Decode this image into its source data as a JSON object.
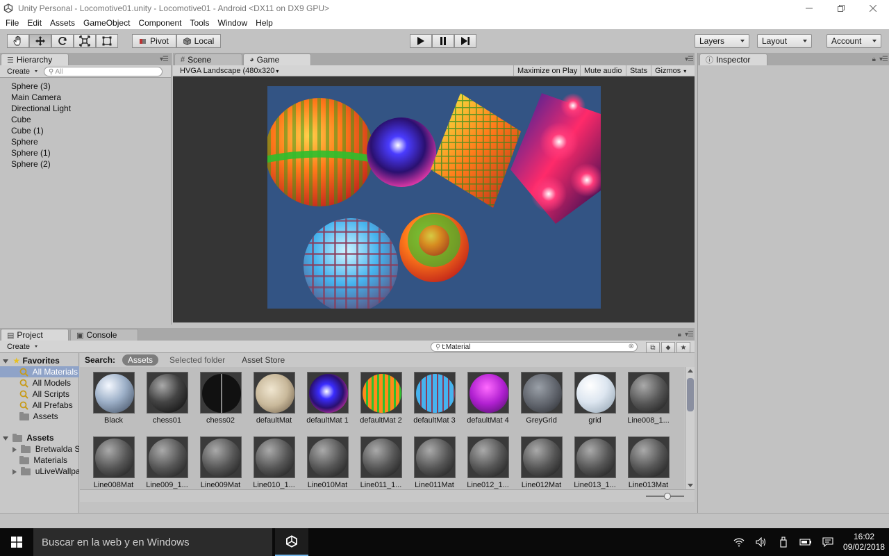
{
  "window": {
    "title": "Unity Personal - Locomotive01.unity - Locomotive01 - Android <DX11 on DX9 GPU>"
  },
  "menu": [
    "File",
    "Edit",
    "Assets",
    "GameObject",
    "Component",
    "Tools",
    "Window",
    "Help"
  ],
  "toolbar": {
    "pivot_label": "Pivot",
    "local_label": "Local",
    "layers_label": "Layers",
    "layout_label": "Layout",
    "account_label": "Account"
  },
  "hierarchy": {
    "tab_label": "Hierarchy",
    "create_label": "Create",
    "search_placeholder": "All",
    "items": [
      "Sphere (3)",
      "Main Camera",
      "Directional Light",
      "Cube",
      "Cube (1)",
      "Sphere",
      "Sphere (1)",
      "Sphere (2)"
    ]
  },
  "scene_tab": {
    "label": "Scene"
  },
  "game": {
    "tab_label": "Game",
    "resolution": "HVGA Landscape (480x320",
    "maximize_label": "Maximize on Play",
    "mute_label": "Mute audio",
    "stats_label": "Stats",
    "gizmos_label": "Gizmos"
  },
  "inspector": {
    "tab_label": "Inspector"
  },
  "project": {
    "tab_label": "Project",
    "console_label": "Console",
    "create_label": "Create",
    "search_value": "t:Material",
    "search_label": "Search:",
    "scope_assets": "Assets",
    "scope_selected": "Selected folder",
    "scope_store": "Asset Store",
    "favorites_label": "Favorites",
    "favorites": [
      "All Materials",
      "All Models",
      "All Scripts",
      "All Prefabs",
      "Assets"
    ],
    "assets_label": "Assets",
    "folders": [
      "Bretwalda S",
      "Materials",
      "uLiveWallpa"
    ],
    "materials_row1": [
      "Black",
      "chess01",
      "chess02",
      "defaultMat",
      "defaultMat 1",
      "defaultMat 2",
      "defaultMat 3",
      "defaultMat 4",
      "GreyGrid",
      "grid",
      "Line008_1..."
    ],
    "materials_row2": [
      "Line008Mat",
      "Line009_1...",
      "Line009Mat",
      "Line010_1...",
      "Line010Mat",
      "Line011_1...",
      "Line011Mat",
      "Line012_1...",
      "Line012Mat",
      "Line013_1...",
      "Line013Mat"
    ]
  },
  "taskbar": {
    "search_placeholder": "Buscar en la web y en Windows",
    "time": "16:02",
    "date": "09/02/2018"
  }
}
